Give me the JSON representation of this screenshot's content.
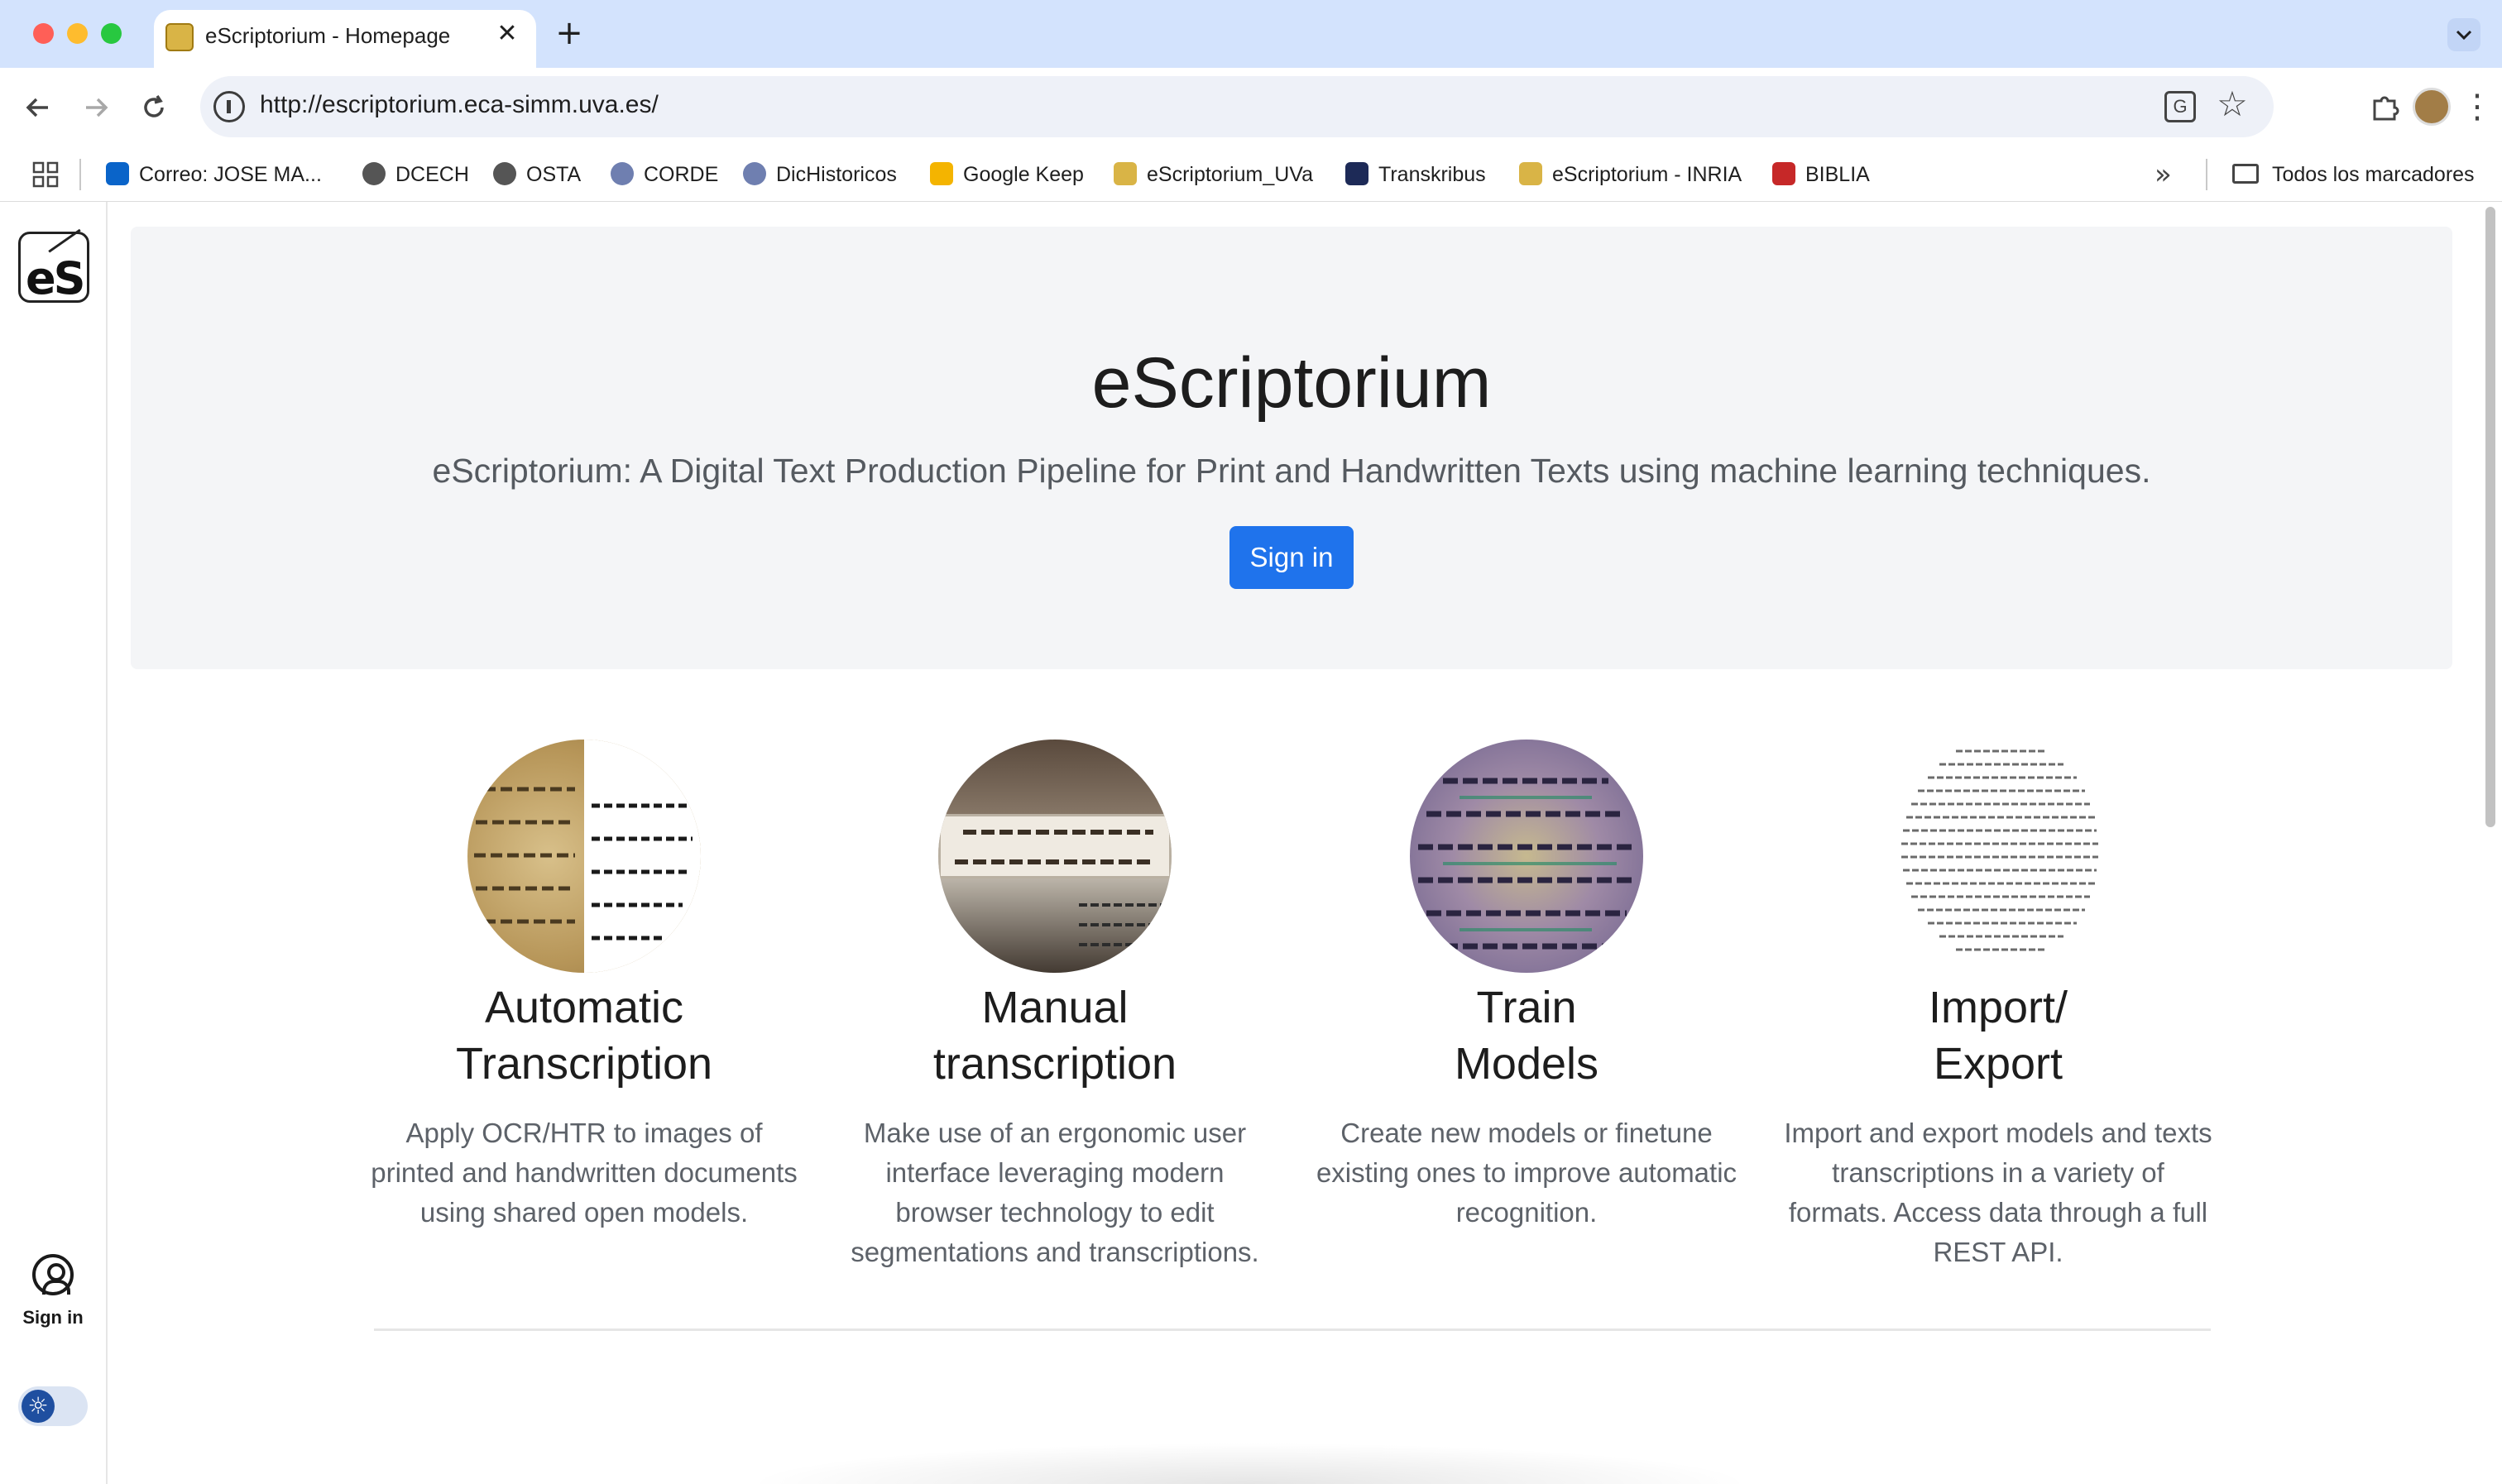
{
  "browser": {
    "tab_title": "eScriptorium - Homepage",
    "tab_close": "✕",
    "new_tab": "+",
    "url": "http://escriptorium.eca-simm.uva.es/",
    "bookmarks": [
      {
        "label": "Correo: JOSE MA...",
        "icon": "outlook-icon",
        "color": "#0a64c9"
      },
      {
        "label": "DCECH",
        "icon": "globe-icon",
        "color": "#555555"
      },
      {
        "label": "OSTA",
        "icon": "globe-icon",
        "color": "#555555"
      },
      {
        "label": "CORDE",
        "icon": "rae-icon",
        "color": "#6f7fb0"
      },
      {
        "label": "DicHistoricos",
        "icon": "rae-icon",
        "color": "#6f7fb0"
      },
      {
        "label": "Google Keep",
        "icon": "keep-icon",
        "color": "#f4b400"
      },
      {
        "label": "eScriptorium_UVa",
        "icon": "escriptorium-icon",
        "color": "#d9b446"
      },
      {
        "label": "Transkribus",
        "icon": "transkribus-icon",
        "color": "#1d2a57"
      },
      {
        "label": "eScriptorium - INRIA",
        "icon": "escriptorium-icon",
        "color": "#d9b446"
      },
      {
        "label": "BIBLIA",
        "icon": "biblia-icon",
        "color": "#c62828"
      }
    ],
    "bookmarks_more": "»",
    "all_bookmarks": "Todos los marcadores"
  },
  "sidebar": {
    "signin_label": "Sign in",
    "theme_icon": "☼"
  },
  "hero": {
    "title": "eScriptorium",
    "subtitle": "eScriptorium: A Digital Text Production Pipeline for Print and Handwritten Texts using machine learning techniques.",
    "signin_button": "Sign in",
    "button_color": "#1f73ec"
  },
  "features": [
    {
      "title_line1": "Automatic",
      "title_line2": "Transcription",
      "description": "Apply OCR/HTR to images of printed and handwritten documents using shared open models."
    },
    {
      "title_line1": "Manual",
      "title_line2": "transcription",
      "description": "Make use of an ergonomic user interface leveraging modern browser technology to edit segmentations and transcriptions."
    },
    {
      "title_line1": "Train",
      "title_line2": "Models",
      "description": "Create new models or finetune existing ones to improve automatic recognition."
    },
    {
      "title_line1": "Import/",
      "title_line2": "Export",
      "description": "Import and export models and texts transcriptions in a variety of formats. Access data through a full REST API."
    }
  ]
}
